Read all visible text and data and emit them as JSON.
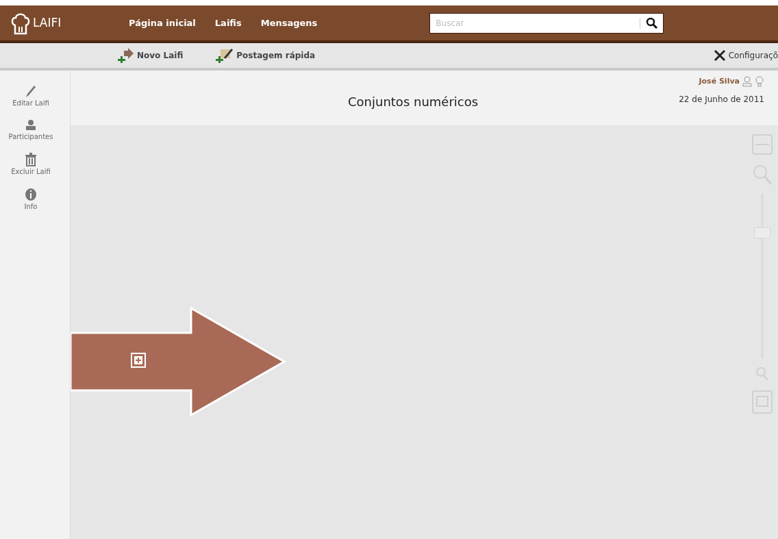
{
  "logo": {
    "text": "LAIFI"
  },
  "nav": [
    {
      "label": "Página inicial"
    },
    {
      "label": "Laifis"
    },
    {
      "label": "Mensagens"
    }
  ],
  "search": {
    "placeholder": "Buscar"
  },
  "toolbar": [
    {
      "label": "Novo Laifi",
      "kind": "new"
    },
    {
      "label": "Postagem rápida",
      "kind": "post"
    }
  ],
  "settings": {
    "label": "Configuraçõ"
  },
  "sidebar": [
    {
      "label": "Editar Laifi",
      "kind": "edit"
    },
    {
      "label": "Participantes",
      "kind": "people"
    },
    {
      "label": "Excluir Laifi",
      "kind": "delete"
    },
    {
      "label": "Info",
      "kind": "info"
    }
  ],
  "header": {
    "title": "Conjuntos numéricos",
    "user": "José Silva",
    "date": "22 de Junho de 2011"
  },
  "zoom": {
    "level": 0.78
  }
}
